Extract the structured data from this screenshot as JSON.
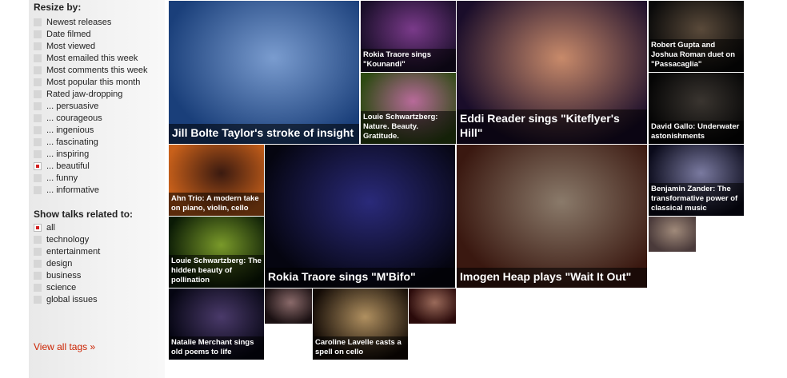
{
  "resize": {
    "title": "Resize by:",
    "options": [
      {
        "label": "Newest releases",
        "selected": false
      },
      {
        "label": "Date filmed",
        "selected": false
      },
      {
        "label": "Most viewed",
        "selected": false
      },
      {
        "label": "Most emailed this week",
        "selected": false
      },
      {
        "label": "Most comments this week",
        "selected": false
      },
      {
        "label": "Most popular this month",
        "selected": false
      },
      {
        "label": "Rated jaw-dropping",
        "selected": false
      },
      {
        "label": "... persuasive",
        "selected": false
      },
      {
        "label": "... courageous",
        "selected": false
      },
      {
        "label": "... ingenious",
        "selected": false
      },
      {
        "label": "... fascinating",
        "selected": false
      },
      {
        "label": "... inspiring",
        "selected": false
      },
      {
        "label": "... beautiful",
        "selected": true
      },
      {
        "label": "... funny",
        "selected": false
      },
      {
        "label": "... informative",
        "selected": false
      }
    ]
  },
  "related": {
    "title": "Show talks related to:",
    "options": [
      {
        "label": "all",
        "selected": true
      },
      {
        "label": "technology",
        "selected": false
      },
      {
        "label": "entertainment",
        "selected": false
      },
      {
        "label": "design",
        "selected": false
      },
      {
        "label": "business",
        "selected": false
      },
      {
        "label": "science",
        "selected": false
      },
      {
        "label": "global issues",
        "selected": false
      }
    ]
  },
  "view_all": "View all tags »",
  "tiles": [
    {
      "caption": "Jill Bolte Taylor's stroke of insight",
      "size": "big",
      "colors": [
        "#1a3f7a",
        "#7a9ccf"
      ]
    },
    {
      "caption": "Rokia Traore sings \"Kounandi\"",
      "size": "small",
      "colors": [
        "#1a0f2a",
        "#7a3a8a"
      ]
    },
    {
      "caption": "Louie Schwartzberg: Nature. Beauty. Gratitude.",
      "size": "small",
      "colors": [
        "#2d4a12",
        "#b86a9a"
      ]
    },
    {
      "caption": "Eddi Reader sings \"Kiteflyer's Hill\"",
      "size": "big",
      "colors": [
        "#1a0d2a",
        "#c88a6a"
      ]
    },
    {
      "caption": "Robert Gupta and Joshua Roman duet on \"Passacaglia\"",
      "size": "small",
      "colors": [
        "#0a0a0a",
        "#5a4a3a"
      ]
    },
    {
      "caption": "David Gallo: Underwater astonishments",
      "size": "small",
      "colors": [
        "#050505",
        "#3a3530"
      ]
    },
    {
      "caption": "Ahn Trio: A modern take on piano, violin, cello",
      "size": "small",
      "colors": [
        "#c8601a",
        "#3a1a10"
      ]
    },
    {
      "caption": "Rokia Traore sings \"M'Bifo\"",
      "size": "big",
      "colors": [
        "#050510",
        "#2a2a7a"
      ]
    },
    {
      "caption": "Imogen Heap plays \"Wait It Out\"",
      "size": "big",
      "colors": [
        "#3a1810",
        "#8a7a6a"
      ]
    },
    {
      "caption": "Benjamin Zander: The transformative power of classical music",
      "size": "small",
      "colors": [
        "#0a0a1a",
        "#7a7aa0"
      ]
    },
    {
      "caption": "",
      "size": "none",
      "colors": [
        "#4a3a3a",
        "#a08a7a"
      ]
    },
    {
      "caption": "Louie Schwartzberg: The hidden beauty of pollination",
      "size": "small",
      "colors": [
        "#0a1a05",
        "#7a9a2a"
      ]
    },
    {
      "caption": "Natalie Merchant sings old poems to life",
      "size": "small",
      "colors": [
        "#050512",
        "#4a3a6a"
      ]
    },
    {
      "caption": "",
      "size": "none",
      "colors": [
        "#1a1012",
        "#8a6a6a"
      ]
    },
    {
      "caption": "Caroline Lavelle casts a spell on cello",
      "size": "small",
      "colors": [
        "#120a05",
        "#b09060"
      ]
    },
    {
      "caption": "",
      "size": "none",
      "colors": [
        "#2a0a0a",
        "#9a6a5a"
      ]
    }
  ]
}
